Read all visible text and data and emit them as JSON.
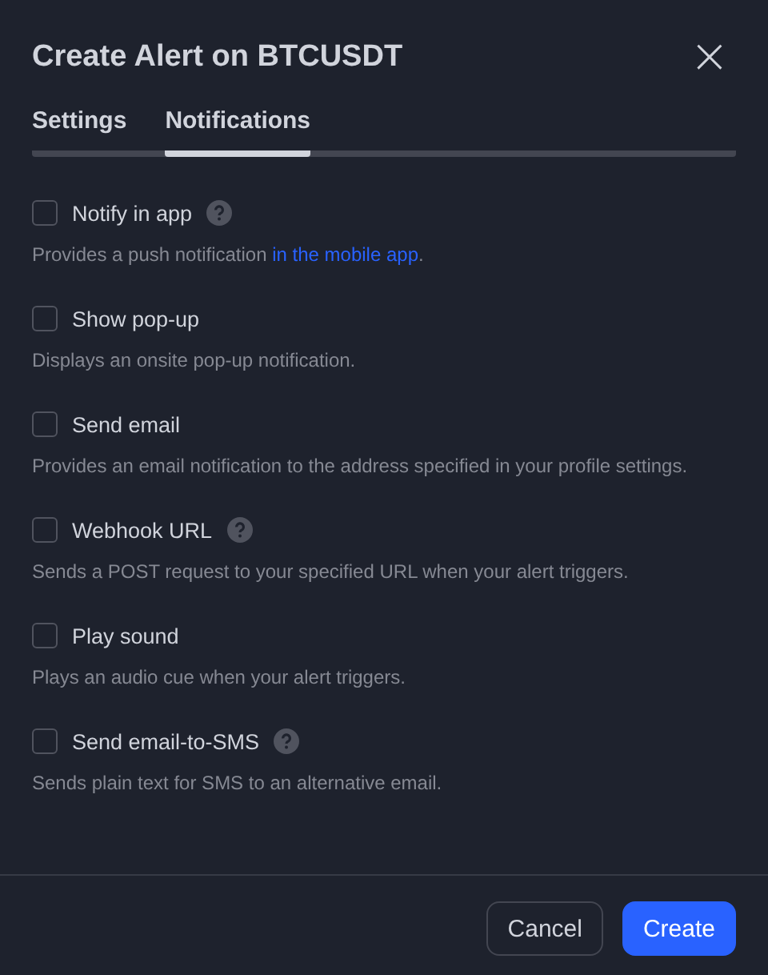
{
  "dialog": {
    "title": "Create Alert on BTCUSDT",
    "close_icon": "×"
  },
  "tabs": [
    {
      "label": "Settings",
      "selected": false
    },
    {
      "label": "Notifications",
      "selected": true
    }
  ],
  "options": [
    {
      "label": "Notify in app",
      "checked": false,
      "help": true,
      "description": "Provides a push notification ",
      "link": "in the mobile app",
      "description_end": "."
    },
    {
      "label": "Show pop-up",
      "checked": false,
      "help": false,
      "description": "Displays an onsite pop-up notification."
    },
    {
      "label": "Send email",
      "checked": false,
      "help": false,
      "description": "Provides an email notification to the address specified in your profile settings."
    },
    {
      "label": "Webhook URL",
      "checked": false,
      "help": true,
      "description": "Sends a POST request to your specified URL when your alert triggers."
    },
    {
      "label": "Play sound",
      "checked": false,
      "help": false,
      "description": "Plays an audio cue when your alert triggers."
    },
    {
      "label": "Send email-to-SMS",
      "checked": false,
      "help": true,
      "description": "Sends plain text for SMS to an alternative email."
    }
  ],
  "buttons": [
    {
      "label": "Cancel",
      "kind": "secondary"
    },
    {
      "label": "Create",
      "kind": "primary"
    }
  ]
}
